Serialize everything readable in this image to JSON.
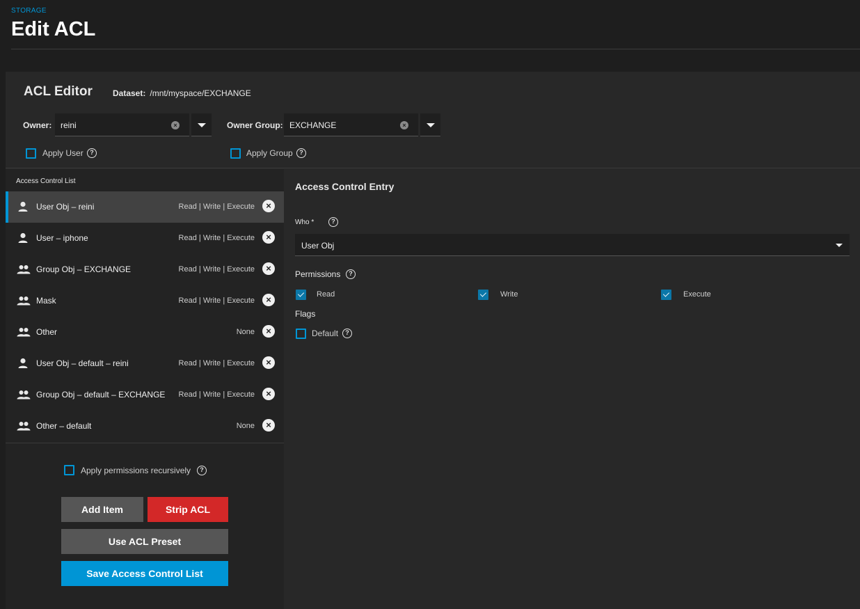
{
  "header": {
    "breadcrumb": "STORAGE",
    "title": "Edit ACL"
  },
  "editor": {
    "title": "ACL Editor",
    "dataset_label": "Dataset:",
    "dataset_path": "/mnt/myspace/EXCHANGE",
    "owner": {
      "label": "Owner:",
      "value": "reini",
      "apply_label": "Apply User",
      "apply_checked": false
    },
    "owner_group": {
      "label": "Owner Group:",
      "value": "EXCHANGE",
      "apply_label": "Apply Group",
      "apply_checked": false
    }
  },
  "acl_list": {
    "header": "Access Control List",
    "items": [
      {
        "name": "User Obj – reini",
        "perm": "Read | Write | Execute",
        "icon": "user-icon",
        "selected": true
      },
      {
        "name": "User – iphone",
        "perm": "Read | Write | Execute",
        "icon": "user-icon",
        "selected": false
      },
      {
        "name": "Group Obj – EXCHANGE",
        "perm": "Read | Write | Execute",
        "icon": "group-icon",
        "selected": false
      },
      {
        "name": "Mask",
        "perm": "Read | Write | Execute",
        "icon": "group-icon",
        "selected": false
      },
      {
        "name": "Other",
        "perm": "None",
        "icon": "group-icon",
        "selected": false
      },
      {
        "name": "User Obj – default – reini",
        "perm": "Read | Write | Execute",
        "icon": "user-icon",
        "selected": false
      },
      {
        "name": "Group Obj – default – EXCHANGE",
        "perm": "Read | Write | Execute",
        "icon": "group-icon",
        "selected": false
      },
      {
        "name": "Other – default",
        "perm": "None",
        "icon": "group-icon",
        "selected": false
      }
    ]
  },
  "recursive": {
    "label": "Apply permissions recursively",
    "checked": false
  },
  "buttons": {
    "add_item": "Add Item",
    "strip_acl": "Strip ACL",
    "use_preset": "Use ACL Preset",
    "save": "Save Access Control List"
  },
  "entry": {
    "title": "Access Control Entry",
    "who_label": "Who *",
    "who_value": "User Obj",
    "permissions_label": "Permissions",
    "permissions": [
      {
        "label": "Read",
        "checked": true
      },
      {
        "label": "Write",
        "checked": true
      },
      {
        "label": "Execute",
        "checked": true
      }
    ],
    "flags_label": "Flags",
    "default_label": "Default",
    "default_checked": false
  },
  "colors": {
    "accent": "#0095d5",
    "danger": "#d32828",
    "background": "#1e1e1e",
    "panel": "#282828"
  }
}
